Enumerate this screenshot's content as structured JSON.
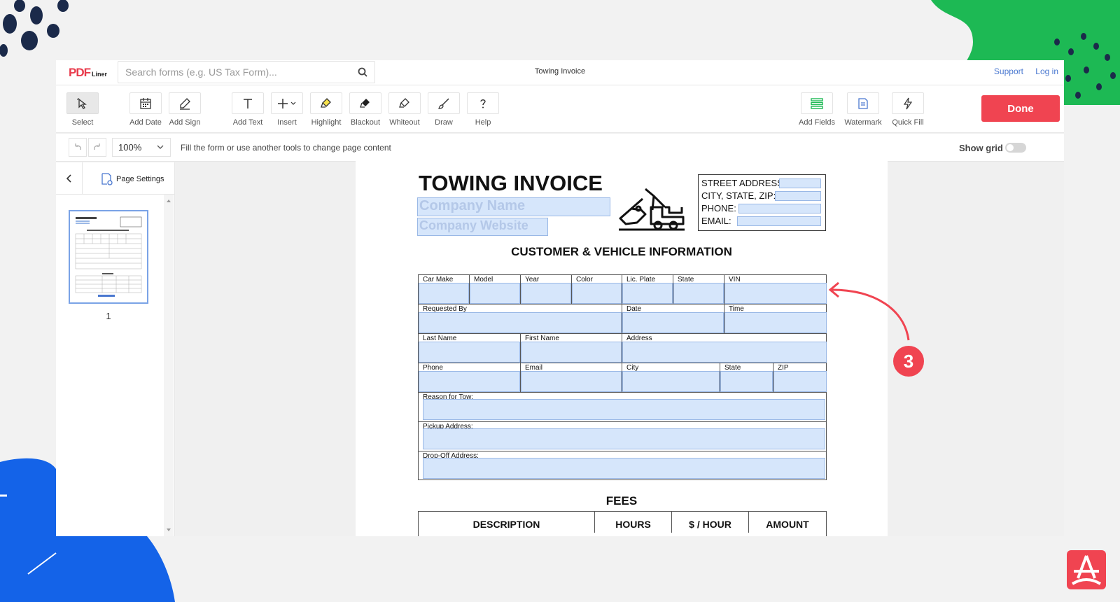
{
  "topbar": {
    "logo_main": "PDF",
    "logo_sub": "Liner",
    "search_placeholder": "Search forms (e.g. US Tax Form)...",
    "document_title": "Towing Invoice",
    "support_link": "Support",
    "login_link": "Log in"
  },
  "toolbar": {
    "tools": [
      {
        "label": "Select",
        "icon": "cursor-icon"
      },
      {
        "label": "Add Date",
        "icon": "calendar-icon"
      },
      {
        "label": "Add Sign",
        "icon": "pen-sign-icon"
      },
      {
        "label": "Add Text",
        "icon": "text-icon"
      },
      {
        "label": "Insert",
        "icon": "plus-icon"
      },
      {
        "label": "Highlight",
        "icon": "highlighter-icon"
      },
      {
        "label": "Blackout",
        "icon": "marker-black-icon"
      },
      {
        "label": "Whiteout",
        "icon": "marker-white-icon"
      },
      {
        "label": "Draw",
        "icon": "brush-icon"
      },
      {
        "label": "Help",
        "icon": "question-icon"
      },
      {
        "label": "Add Fields",
        "icon": "fields-icon"
      },
      {
        "label": "Watermark",
        "icon": "watermark-icon"
      },
      {
        "label": "Quick Fill",
        "icon": "lightning-icon"
      }
    ],
    "done_label": "Done",
    "accent": "#f04451"
  },
  "subbar": {
    "zoom": "100%",
    "hint": "Fill the form or use another tools to change page content",
    "show_grid_label": "Show grid",
    "show_grid_on": false
  },
  "sidebar": {
    "page_settings_label": "Page Settings",
    "thumb_page_number": "1"
  },
  "document": {
    "title": "TOWING INVOICE",
    "company_name_placeholder": "Company Name",
    "company_website_placeholder": "Company Website",
    "address_labels": [
      "STREET ADDRESS:",
      "CITY, STATE, ZIP:",
      "PHONE:",
      "EMAIL:"
    ],
    "section_customer": "CUSTOMER & VEHICLE INFORMATION",
    "row1": [
      "Car Make",
      "Model",
      "Year",
      "Color",
      "Lic. Plate",
      "State",
      "VIN"
    ],
    "row2": [
      "Requested By",
      "Date",
      "Time"
    ],
    "row3": [
      "Last Name",
      "First Name",
      "Address"
    ],
    "row4": [
      "Phone",
      "Email",
      "City",
      "State",
      "ZIP"
    ],
    "reason_label": "Reason for Tow:",
    "pickup_label": "Pickup Address:",
    "dropoff_label": "Drop-Off Address:",
    "section_fees": "FEES",
    "fees_headers": [
      "DESCRIPTION",
      "HOURS",
      "$ / HOUR",
      "AMOUNT"
    ]
  },
  "annotation": {
    "step_number": "3",
    "color": "#f04451"
  }
}
